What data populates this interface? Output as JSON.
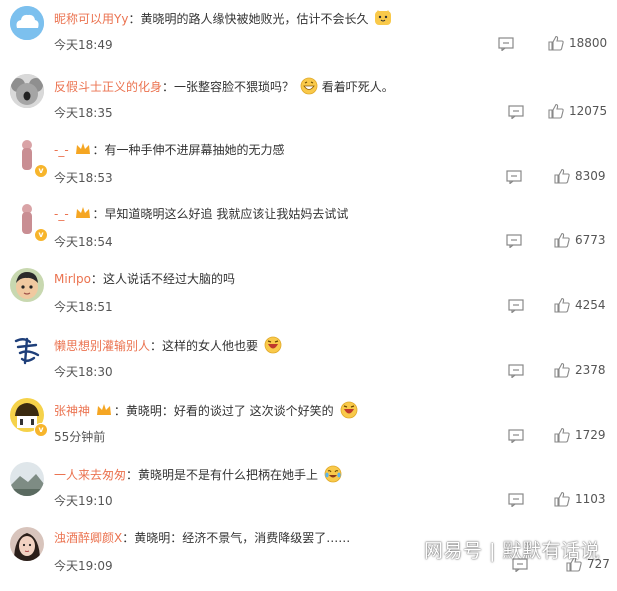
{
  "comments": [
    {
      "username": "昵称可以用Yy",
      "text": "黄晓明的路人缘快被她败光，估计不会长久",
      "time": "今天18:49",
      "likes": "18800"
    },
    {
      "username": "反假斗士正义的化身",
      "text": "一张整容脸不猥琐吗？",
      "text2": "看着吓死人。",
      "time": "今天18:35",
      "likes": "12075"
    },
    {
      "username": "-_-",
      "text": "有一种手伸不进屏幕抽她的无力感",
      "time": "今天18:53",
      "likes": "8309"
    },
    {
      "username": "-_-",
      "text": "早知道晓明这么好追 我就应该让我姑妈去试试",
      "time": "今天18:54",
      "likes": "6773"
    },
    {
      "username": "Mirlpo",
      "text": "这人说话不经过大脑的吗",
      "time": "今天18:51",
      "likes": "4254"
    },
    {
      "username": "懒思想别灌输别人",
      "text": "这样的女人他也要",
      "time": "今天18:30",
      "likes": "2378"
    },
    {
      "username": "张神神",
      "text": "黄晓明：好看的谈过了 这次谈个好笑的",
      "time": "55分钟前",
      "likes": "1729"
    },
    {
      "username": "一人来去匆匆",
      "text": "黄晓明是不是有什么把柄在她手上",
      "time": "今天19:10",
      "likes": "1103"
    },
    {
      "username": "浊酒醉卿颜X",
      "text": "黄晓明：经济不景气，消费降级罢了……",
      "time": "今天19:09",
      "likes": "727"
    }
  ],
  "separator": "：",
  "watermark": "网易号 | 默默有话说",
  "colors": {
    "username": "#eb7350",
    "badge": "#f7b52c",
    "text": "#333333"
  }
}
